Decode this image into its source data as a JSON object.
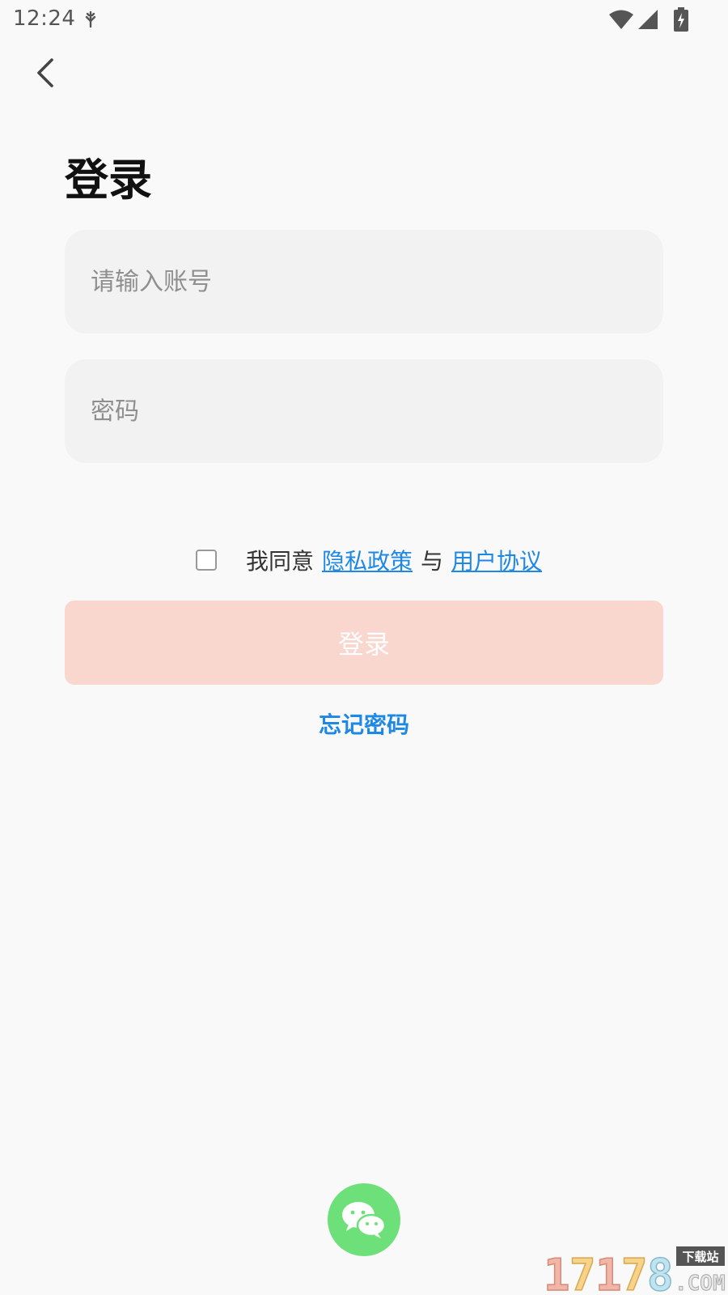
{
  "status_bar": {
    "time": "12:24",
    "notification_icon": "usb-debug-icon",
    "wifi_icon": "wifi-icon",
    "signal_icon": "cell-signal-icon",
    "battery_icon": "battery-charging-icon"
  },
  "header": {
    "back_icon": "chevron-left-icon",
    "title": "登录"
  },
  "form": {
    "account": {
      "placeholder": "请输入账号",
      "value": ""
    },
    "password": {
      "placeholder": "密码",
      "value": ""
    }
  },
  "agreement": {
    "checked": false,
    "lead_text": "我同意",
    "privacy_link": "隐私政策",
    "and_text": "与",
    "terms_link": "用户协议"
  },
  "login_button": {
    "label": "登录",
    "color": "#f9d6ce"
  },
  "forgot_password": {
    "label": "忘记密码"
  },
  "wechat": {
    "icon": "wechat-icon",
    "color": "#6ee07a"
  },
  "watermark": {
    "icon": "17178-watermark-logo",
    "text": "17178.COM 下载站"
  },
  "colors": {
    "background": "#f9f9f9",
    "link": "#1e88e5",
    "input_background": "#f2f2f2"
  }
}
